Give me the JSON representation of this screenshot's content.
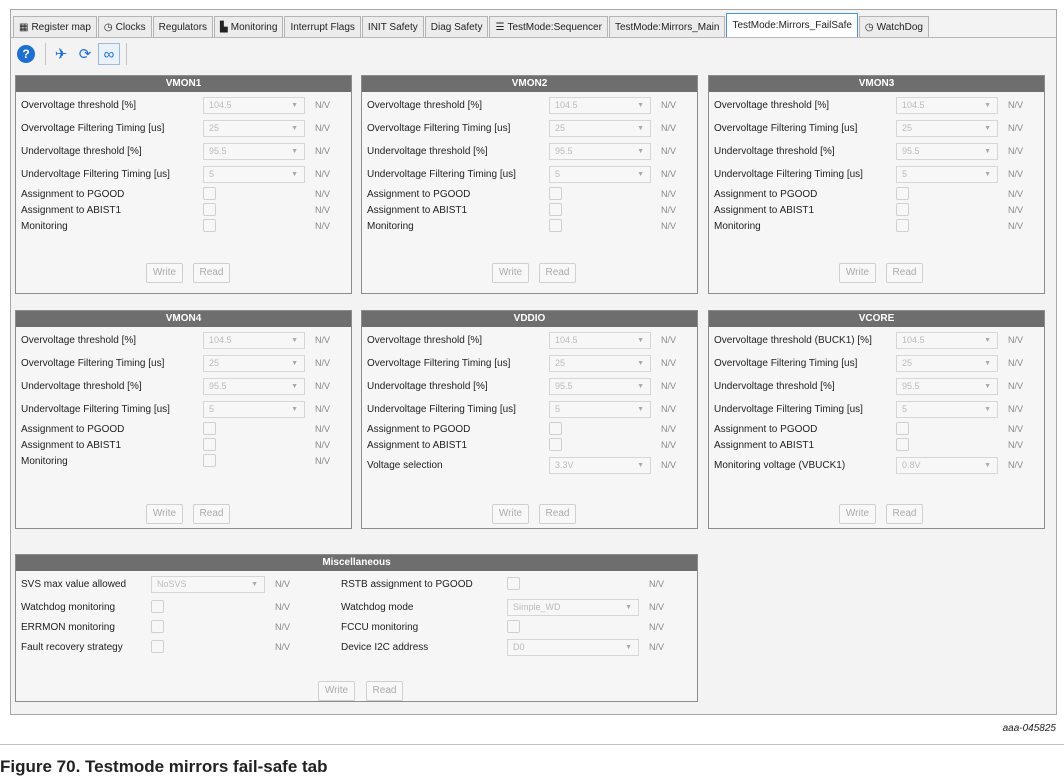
{
  "tabs": [
    {
      "label": "Register map",
      "icon": "grid-icon",
      "glyph": "▦"
    },
    {
      "label": "Clocks",
      "icon": "clock-icon",
      "glyph": "◷"
    },
    {
      "label": "Regulators",
      "icon": "",
      "glyph": ""
    },
    {
      "label": "Monitoring",
      "icon": "monitoring-icon",
      "glyph": "▙"
    },
    {
      "label": "Interrupt Flags",
      "icon": "",
      "glyph": ""
    },
    {
      "label": "INIT Safety",
      "icon": "",
      "glyph": ""
    },
    {
      "label": "Diag Safety",
      "icon": "",
      "glyph": ""
    },
    {
      "label": "TestMode:Sequencer",
      "icon": "list-icon",
      "glyph": "☰"
    },
    {
      "label": "TestMode:Mirrors_Main",
      "icon": "",
      "glyph": ""
    },
    {
      "label": "TestMode:Mirrors_FailSafe",
      "icon": "",
      "glyph": "",
      "active": true
    },
    {
      "label": "WatchDog",
      "icon": "clock-icon",
      "glyph": "◷"
    }
  ],
  "toolbar": {
    "help_glyph": "?",
    "send_glyph": "✈",
    "refresh_glyph": "⟳",
    "loop_glyph": "∞"
  },
  "common": {
    "nv": "N/V",
    "write": "Write",
    "read": "Read"
  },
  "vmon1": {
    "title": "VMON1",
    "ov_label": "Overvoltage threshold [%]",
    "ov_value": "104.5",
    "ovf_label": "Overvoltage Filtering Timing [us]",
    "ovf_value": "25",
    "uv_label": "Undervoltage threshold [%]",
    "uv_value": "95.5",
    "uvf_label": "Undervoltage Filtering Timing [us]",
    "uvf_value": "5",
    "pgood_label": "Assignment to PGOOD",
    "abist_label": "Assignment to ABIST1",
    "mon_label": "Monitoring"
  },
  "vmon2": {
    "title": "VMON2",
    "ov_label": "Overvoltage threshold [%]",
    "ov_value": "104.5",
    "ovf_label": "Overvoltage Filtering Timing [us]",
    "ovf_value": "25",
    "uv_label": "Undervoltage threshold [%]",
    "uv_value": "95.5",
    "uvf_label": "Undervoltage Filtering Timing [us]",
    "uvf_value": "5",
    "pgood_label": "Assignment to PGOOD",
    "abist_label": "Assignment to ABIST1",
    "mon_label": "Monitoring"
  },
  "vmon3": {
    "title": "VMON3",
    "ov_label": "Overvoltage threshold [%]",
    "ov_value": "104.5",
    "ovf_label": "Overvoltage Filtering Timing [us]",
    "ovf_value": "25",
    "uv_label": "Undervoltage threshold [%]",
    "uv_value": "95.5",
    "uvf_label": "Undervoltage Filtering Timing [us]",
    "uvf_value": "5",
    "pgood_label": "Assignment to PGOOD",
    "abist_label": "Assignment to ABIST1",
    "mon_label": "Monitoring"
  },
  "vmon4": {
    "title": "VMON4",
    "ov_label": "Overvoltage threshold [%]",
    "ov_value": "104.5",
    "ovf_label": "Overvoltage Filtering Timing [us]",
    "ovf_value": "25",
    "uv_label": "Undervoltage threshold [%]",
    "uv_value": "95.5",
    "uvf_label": "Undervoltage Filtering Timing [us]",
    "uvf_value": "5",
    "pgood_label": "Assignment to PGOOD",
    "abist_label": "Assignment to ABIST1",
    "mon_label": "Monitoring"
  },
  "vddio": {
    "title": "VDDIO",
    "ov_label": "Overvoltage threshold [%]",
    "ov_value": "104.5",
    "ovf_label": "Overvoltage Filtering Timing [us]",
    "ovf_value": "25",
    "uv_label": "Undervoltage threshold [%]",
    "uv_value": "95.5",
    "uvf_label": "Undervoltage Filtering Timing [us]",
    "uvf_value": "5",
    "pgood_label": "Assignment to PGOOD",
    "abist_label": "Assignment to ABIST1",
    "vsel_label": "Voltage selection",
    "vsel_value": "3.3V"
  },
  "vcore": {
    "title": "VCORE",
    "ov_label": "Overvoltage threshold (BUCK1) [%]",
    "ov_value": "104.5",
    "ovf_label": "Overvoltage Filtering Timing [us]",
    "ovf_value": "25",
    "uv_label": "Undervoltage threshold [%]",
    "uv_value": "95.5",
    "uvf_label": "Undervoltage Filtering Timing [us]",
    "uvf_value": "5",
    "pgood_label": "Assignment to PGOOD",
    "abist_label": "Assignment to ABIST1",
    "mv_label": "Monitoring voltage (VBUCK1)",
    "mv_value": "0.8V"
  },
  "misc": {
    "title": "Miscellaneous",
    "svs_label": "SVS max value allowed",
    "svs_value": "NoSVS",
    "wdm_label": "Watchdog monitoring",
    "err_label": "ERRMON monitoring",
    "frs_label": "Fault recovery strategy",
    "rstb_label": "RSTB assignment to PGOOD",
    "wdmode_label": "Watchdog mode",
    "wdmode_value": "Simple_WD",
    "fccu_label": "FCCU monitoring",
    "i2c_label": "Device I2C address",
    "i2c_value": "D0"
  },
  "figure_ref": "aaa-045825",
  "caption": "Figure 70.  Testmode mirrors fail-safe tab"
}
